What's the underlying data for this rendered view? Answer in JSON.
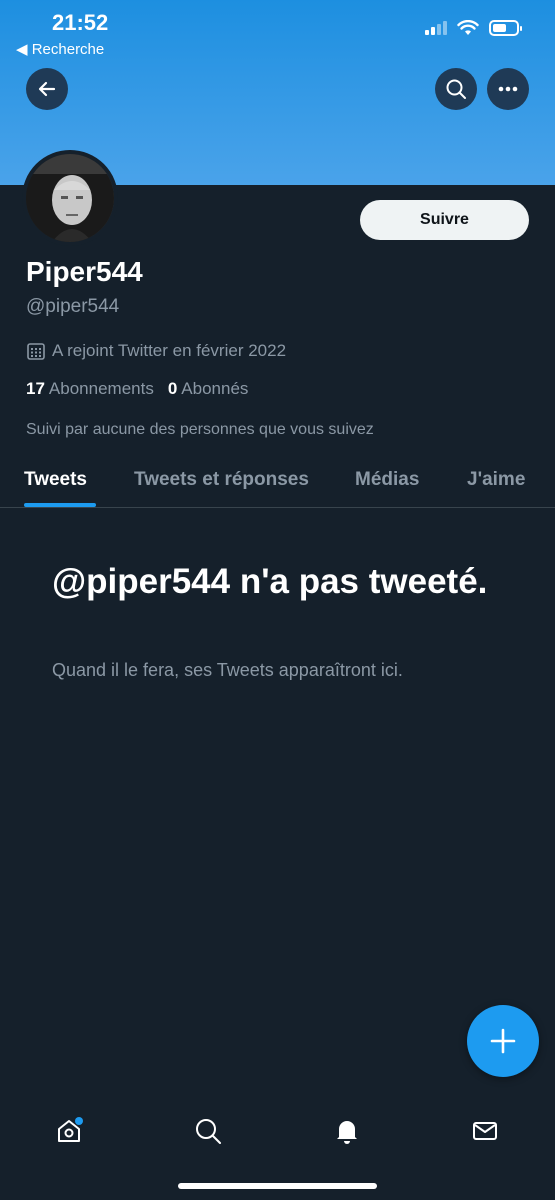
{
  "status_bar": {
    "time": "21:52",
    "back_label": "◀ Recherche"
  },
  "header": {
    "back_icon": "arrow-left-icon",
    "search_icon": "search-icon",
    "more_icon": "more-horizontal-icon",
    "banner_color": "#1d9bf0"
  },
  "profile": {
    "display_name": "Piper544",
    "handle": "@piper544",
    "joined": "A rejoint Twitter en février 2022",
    "following_count": "17",
    "following_label": "Abonnements",
    "followers_count": "0",
    "followers_label": "Abonnés",
    "followed_by": "Suivi par aucune des personnes que vous suivez",
    "follow_button": "Suivre"
  },
  "tabs": [
    {
      "label": "Tweets",
      "active": true
    },
    {
      "label": "Tweets et réponses",
      "active": false
    },
    {
      "label": "Médias",
      "active": false
    },
    {
      "label": "J'aime",
      "active": false
    }
  ],
  "empty_state": {
    "title": "@piper544 n'a pas tweeté.",
    "subtitle": "Quand il le fera, ses Tweets apparaîtront ici."
  },
  "fab": {
    "icon": "plus-icon"
  },
  "bottom_nav": [
    {
      "icon": "home-icon",
      "has_badge": true
    },
    {
      "icon": "search-icon",
      "has_badge": false
    },
    {
      "icon": "bell-icon",
      "has_badge": false
    },
    {
      "icon": "mail-icon",
      "has_badge": false
    }
  ],
  "colors": {
    "background": "#15202b",
    "accent": "#1d9bf0",
    "secondary_text": "#8b98a5"
  }
}
